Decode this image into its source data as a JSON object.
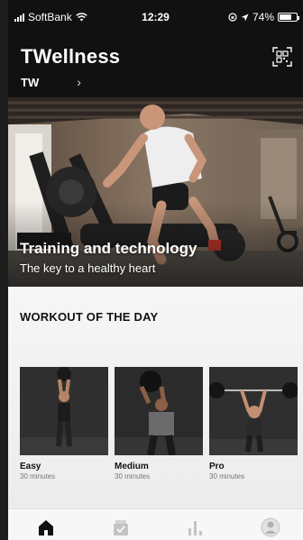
{
  "status_bar": {
    "carrier": "SoftBank",
    "time": "12:29",
    "battery": "74%",
    "battery_level": 0.74
  },
  "header": {
    "title": "TWellness",
    "facility": "TW",
    "chevron": "›"
  },
  "hero": {
    "title": "Training and technology",
    "subtitle": "The key to a healthy heart"
  },
  "workout": {
    "section_title": "WORKOUT OF THE DAY",
    "cards": [
      {
        "level": "Easy",
        "duration": "30 minutes"
      },
      {
        "level": "Medium",
        "duration": "30 minutes"
      },
      {
        "level": "Pro",
        "duration": "30 minutes"
      }
    ]
  },
  "icons": {
    "qr": "qr-scan-icon",
    "tabs": [
      "home-icon",
      "training-icon",
      "stats-icon",
      "profile-icon"
    ]
  },
  "colors": {
    "background": "#141414",
    "content": "#f2f2f2",
    "active_tab": "#111111",
    "inactive_tab": "#c4c4c4"
  }
}
